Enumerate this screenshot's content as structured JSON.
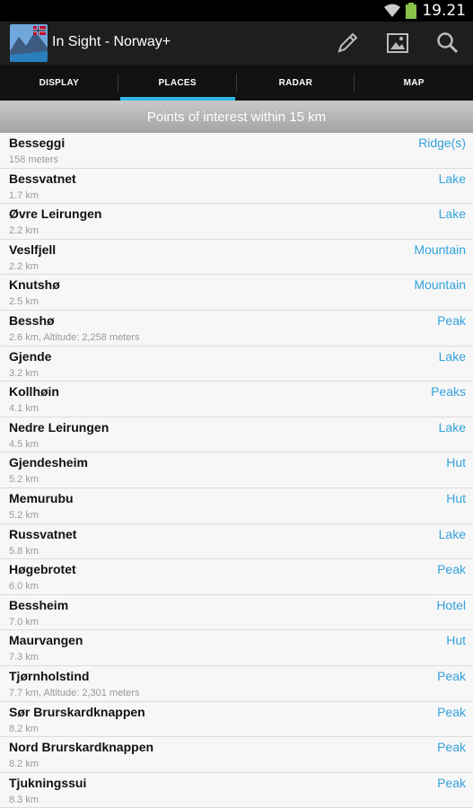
{
  "status": {
    "time": "19.21"
  },
  "app": {
    "title": "In Sight - Norway+"
  },
  "tabs": [
    {
      "label": "DISPLAY"
    },
    {
      "label": "PLACES"
    },
    {
      "label": "RADAR"
    },
    {
      "label": "MAP"
    }
  ],
  "header": "Points of interest within 15 km",
  "places": [
    {
      "name": "Besseggi",
      "distance": "158 meters",
      "type": "Ridge(s)"
    },
    {
      "name": "Bessvatnet",
      "distance": "1.7 km",
      "type": "Lake"
    },
    {
      "name": "Øvre Leirungen",
      "distance": "2.2 km",
      "type": "Lake"
    },
    {
      "name": "Veslfjell",
      "distance": "2.2 km",
      "type": "Mountain"
    },
    {
      "name": "Knutshø",
      "distance": "2.5 km",
      "type": "Mountain"
    },
    {
      "name": "Besshø",
      "distance": "2.6 km, Altitude: 2,258 meters",
      "type": "Peak"
    },
    {
      "name": "Gjende",
      "distance": "3.2 km",
      "type": "Lake"
    },
    {
      "name": "Kollhøin",
      "distance": "4.1 km",
      "type": "Peaks"
    },
    {
      "name": "Nedre Leirungen",
      "distance": "4.5 km",
      "type": "Lake"
    },
    {
      "name": "Gjendesheim",
      "distance": "5.2 km",
      "type": "Hut"
    },
    {
      "name": "Memurubu",
      "distance": "5.2 km",
      "type": "Hut"
    },
    {
      "name": "Russvatnet",
      "distance": "5.8 km",
      "type": "Lake"
    },
    {
      "name": "Høgebrotet",
      "distance": "6.0 km",
      "type": "Peak"
    },
    {
      "name": "Bessheim",
      "distance": "7.0 km",
      "type": "Hotel"
    },
    {
      "name": "Maurvangen",
      "distance": "7.3 km",
      "type": "Hut"
    },
    {
      "name": "Tjørnholstind",
      "distance": "7.7 km, Altitude: 2,301 meters",
      "type": "Peak"
    },
    {
      "name": "Sør Brurskardknappen",
      "distance": "8.2 km",
      "type": "Peak"
    },
    {
      "name": "Nord Brurskardknappen",
      "distance": "8.2 km",
      "type": "Peak"
    },
    {
      "name": "Tjukningssui",
      "distance": "8.3 km",
      "type": "Peak"
    }
  ]
}
